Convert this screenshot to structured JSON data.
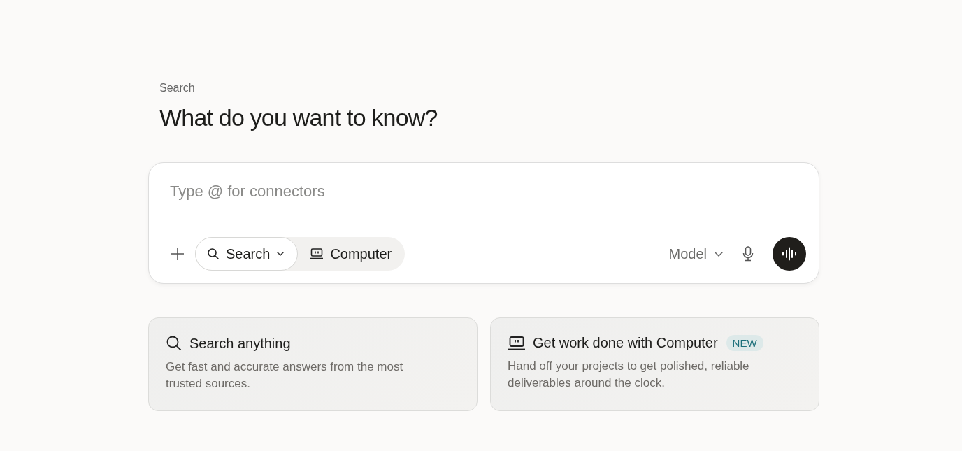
{
  "eyebrow": "Search",
  "title": "What do you want to know?",
  "composer": {
    "placeholder": "Type @ for connectors",
    "modes": [
      {
        "kind": "search",
        "label": "Search",
        "selected": true,
        "dropdown": true
      },
      {
        "kind": "computer",
        "label": "Computer",
        "selected": false,
        "dropdown": false
      }
    ],
    "model": "Model"
  },
  "cards": [
    {
      "kind": "search",
      "title": "Search anything",
      "description": "Get fast and accurate answers from the most trusted sources."
    },
    {
      "kind": "computer",
      "title": "Get work done with Computer",
      "badge": "NEW",
      "description": "Hand off your projects to get polished, reliable deliverables around the clock."
    }
  ]
}
